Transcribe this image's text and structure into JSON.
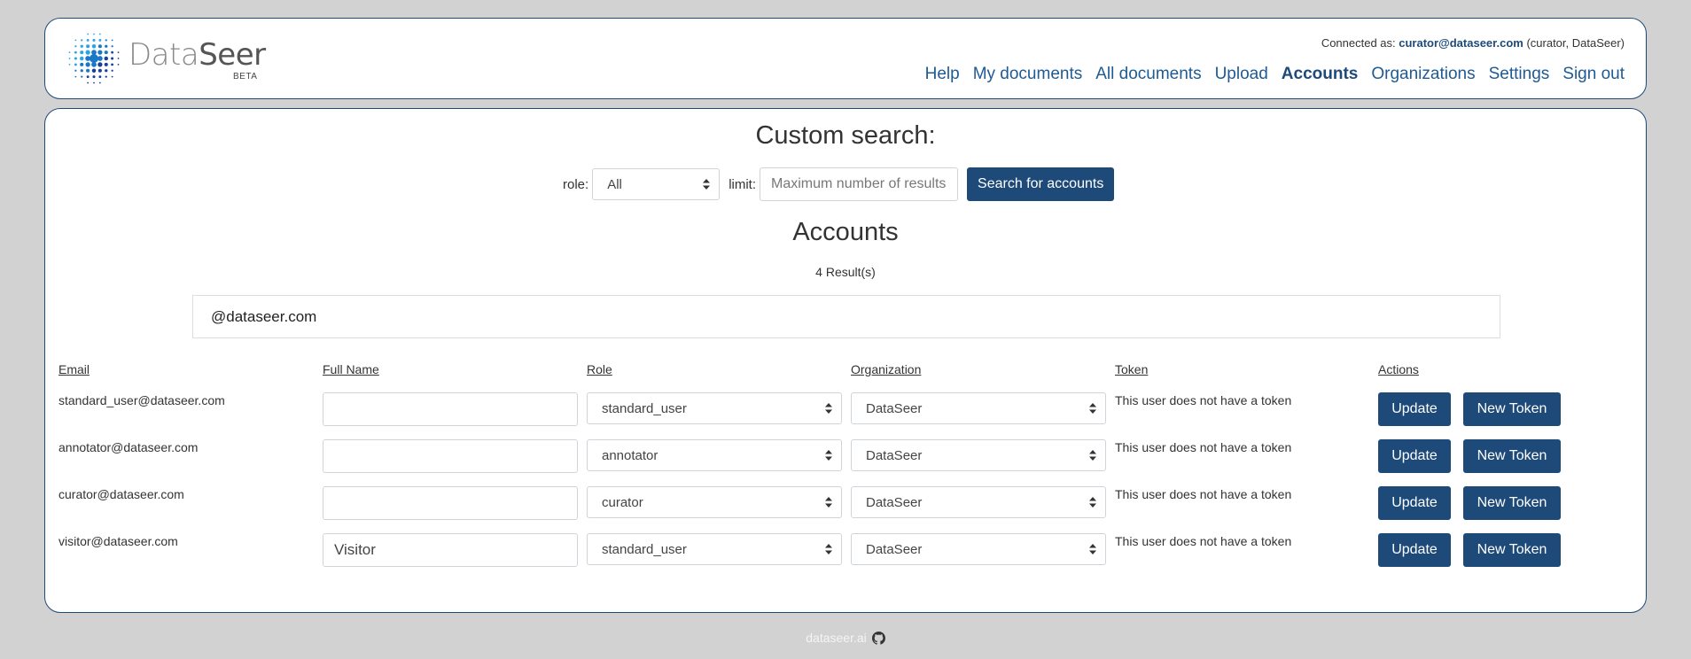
{
  "header": {
    "logo": {
      "word1": "Data",
      "word2": "Seer",
      "badge": "BETA"
    },
    "connected_prefix": "Connected as: ",
    "connected_user": "curator@dataseer.com",
    "connected_suffix": " (curator, DataSeer)",
    "nav": [
      {
        "label": "Help",
        "active": false
      },
      {
        "label": "My documents",
        "active": false
      },
      {
        "label": "All documents",
        "active": false
      },
      {
        "label": "Upload",
        "active": false
      },
      {
        "label": "Accounts",
        "active": true
      },
      {
        "label": "Organizations",
        "active": false
      },
      {
        "label": "Settings",
        "active": false
      },
      {
        "label": "Sign out",
        "active": false
      }
    ]
  },
  "search": {
    "title": "Custom search:",
    "role_label": "role:",
    "role_value": "All",
    "limit_label": "limit:",
    "limit_placeholder": "Maximum number of results",
    "button_label": "Search for accounts"
  },
  "accounts": {
    "title": "Accounts",
    "results": "4 Result(s)",
    "filter_value": "@dataseer.com",
    "columns": [
      "Email",
      "Full Name",
      "Role",
      "Organization",
      "Token",
      "Actions"
    ],
    "rows": [
      {
        "email": "standard_user@dataseer.com",
        "full_name": "",
        "role": "standard_user",
        "organization": "DataSeer",
        "token": "This user does not have a token"
      },
      {
        "email": "annotator@dataseer.com",
        "full_name": "",
        "role": "annotator",
        "organization": "DataSeer",
        "token": "This user does not have a token"
      },
      {
        "email": "curator@dataseer.com",
        "full_name": "",
        "role": "curator",
        "organization": "DataSeer",
        "token": "This user does not have a token"
      },
      {
        "email": "visitor@dataseer.com",
        "full_name": "Visitor",
        "role": "standard_user",
        "organization": "DataSeer",
        "token": "This user does not have a token"
      }
    ],
    "update_label": "Update",
    "new_token_label": "New Token"
  },
  "footer": {
    "link": "dataseer.ai",
    "icon": "github-icon"
  },
  "colors": {
    "primary": "#1e4a7a",
    "background": "#d2d2d2",
    "link": "#1e5a94"
  }
}
